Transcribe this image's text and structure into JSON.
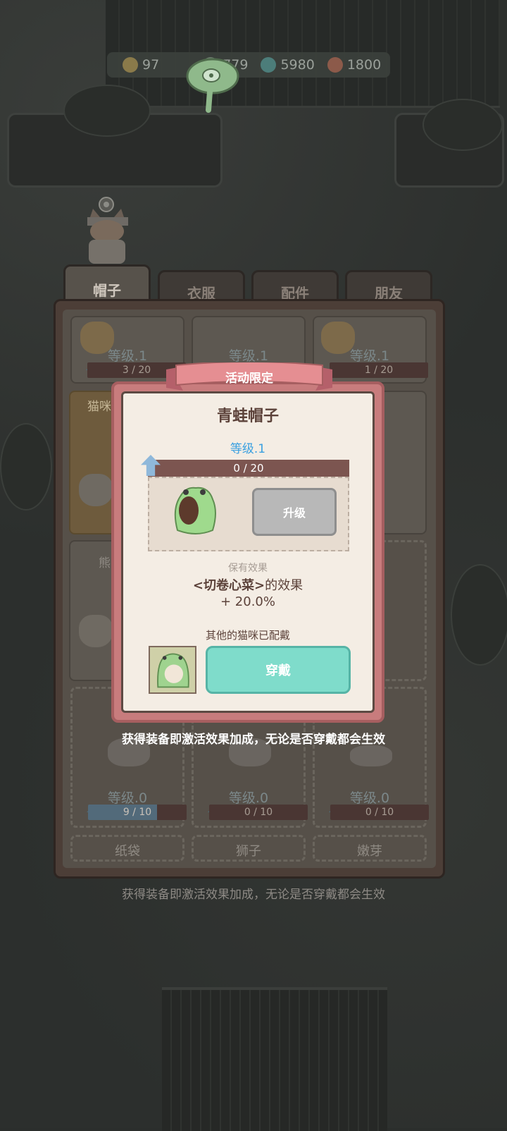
{
  "currency": [
    {
      "icon": "gold-coin-icon",
      "value": "97"
    },
    {
      "icon": "leaf-icon",
      "value": "779"
    },
    {
      "icon": "gem-icon",
      "value": "5980"
    },
    {
      "icon": "fish-icon",
      "value": "1800"
    }
  ],
  "tabs": [
    "帽子",
    "衣服",
    "配件",
    "朋友"
  ],
  "grid": {
    "row1": [
      {
        "level": "等级.1",
        "progress": "3 / 20"
      },
      {
        "level": "等级.1",
        "progress": ""
      },
      {
        "level": "等级.1",
        "progress": "1 / 20"
      }
    ],
    "row2_name_partial": "猫咪",
    "row3_name_partial": "熊",
    "row4": [
      {
        "level": "等级.0",
        "progress": "9 / 10",
        "name": "纸袋"
      },
      {
        "level": "等级.0",
        "progress": "0 / 10",
        "name": "狮子"
      },
      {
        "level": "等级.0",
        "progress": "0 / 10",
        "name": "嫩芽"
      }
    ]
  },
  "bottom_note": "获得装备即激活效果加成，无论是否穿戴都会生效",
  "modal": {
    "ribbon": "活动限定",
    "title": "青蛙帽子",
    "level": "等级.1",
    "progress": "0 / 20",
    "upgrade": "升级",
    "effect_label": "保有效果",
    "effect_target": "<切卷心菜>",
    "effect_suffix": "的效果",
    "effect_value": "+ 20.0%",
    "other_cat": "其他的猫咪已配戴",
    "wear": "穿戴",
    "note": "获得装备即激活效果加成，无论是否穿戴都会生效"
  },
  "colors": {
    "ribbon": "#c87c7d",
    "wear_button": "#7fdccb",
    "level_text": "#3aa0e0"
  }
}
